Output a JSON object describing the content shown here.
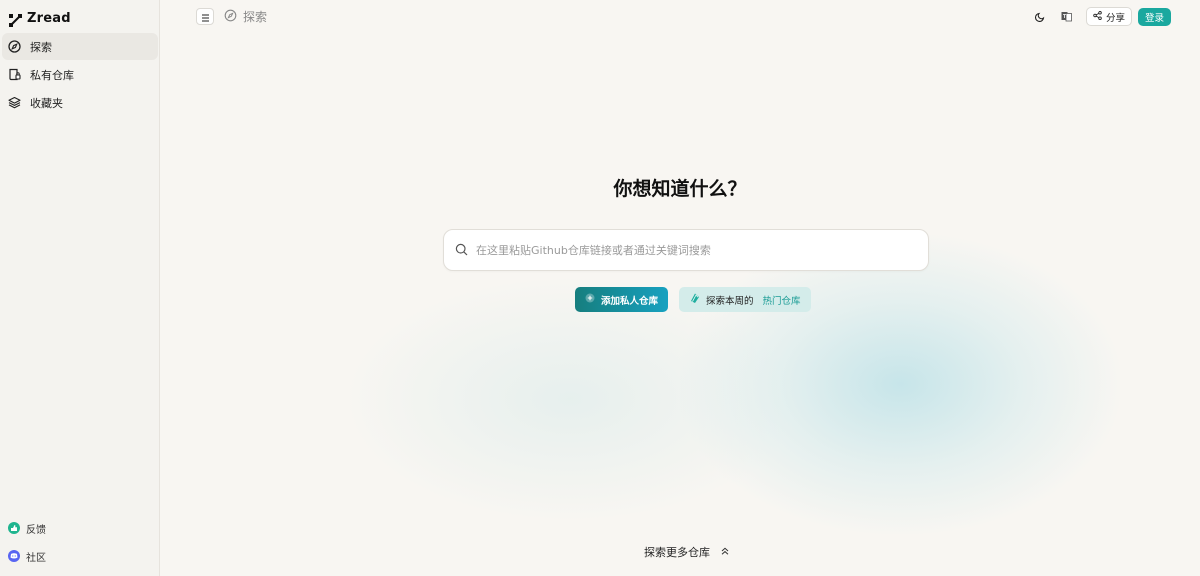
{
  "app": {
    "name": "Zread"
  },
  "sidebar": {
    "items": [
      {
        "label": "探索",
        "icon": "compass-icon",
        "active": true
      },
      {
        "label": "私有仓库",
        "icon": "private-repo-icon",
        "active": false
      },
      {
        "label": "收藏夹",
        "icon": "layers-icon",
        "active": false
      }
    ],
    "bottom": [
      {
        "label": "反馈",
        "icon": "feedback-icon"
      },
      {
        "label": "社区",
        "icon": "discord-icon"
      }
    ]
  },
  "header": {
    "breadcrumb": "探索",
    "share_label": "分享",
    "login_label": "登录"
  },
  "main": {
    "title": "你想知道什么？",
    "search_placeholder": "在这里粘贴Github仓库链接或者通过关键词搜索",
    "add_private_label": "添加私人仓库",
    "explore_label": "探索本周的",
    "hot_label": "热门仓库",
    "more_label": "探索更多仓库"
  },
  "colors": {
    "accent": "#1aa89f",
    "primary_gradient_start": "#167e7e",
    "primary_gradient_end": "#17a1c0",
    "secondary_bg": "#d4ecea"
  }
}
